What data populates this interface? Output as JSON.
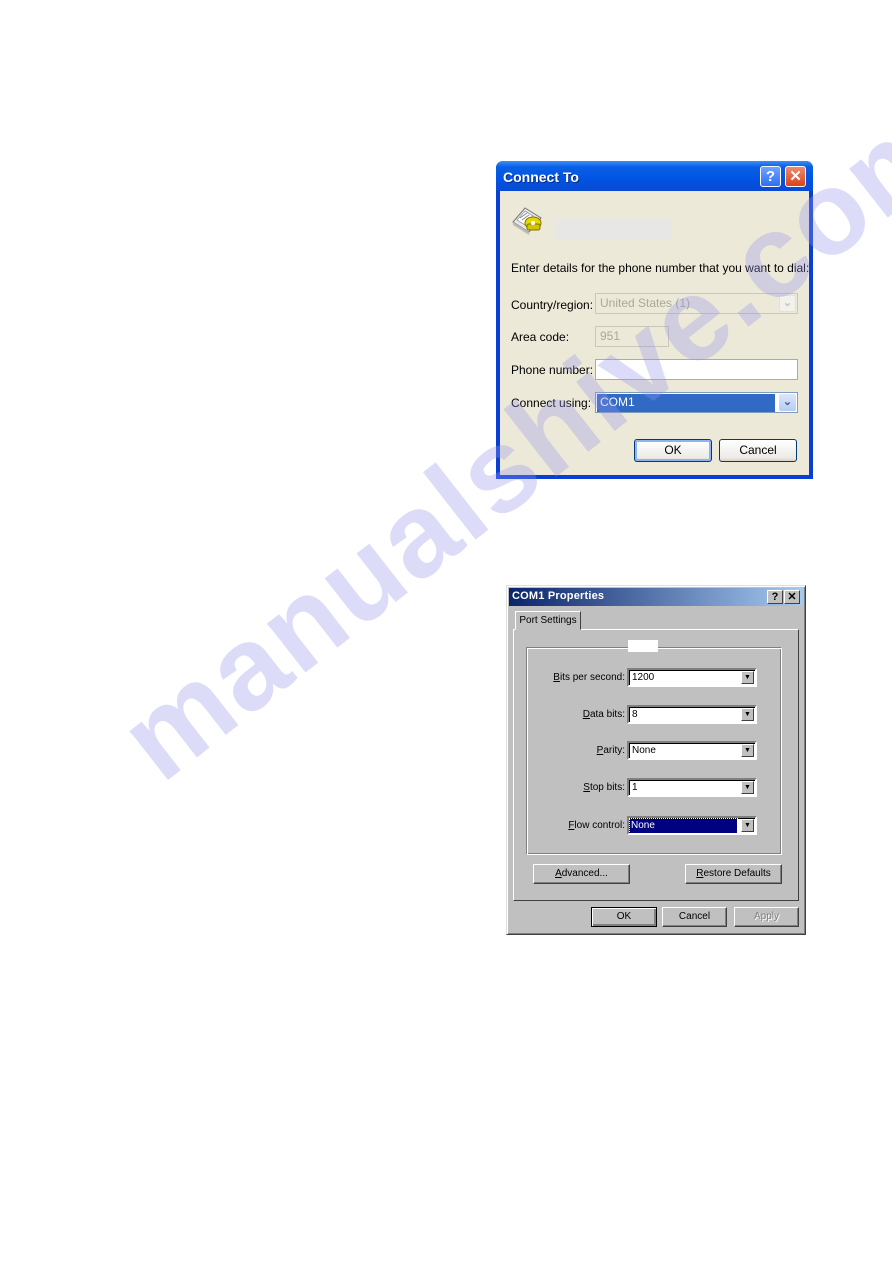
{
  "watermark": "manualshive.com",
  "connect_to": {
    "title": "Connect To",
    "help_glyph": "?",
    "close_glyph": "✕",
    "icon": "phone-fax-icon",
    "instructions": "Enter details for the phone number that you want to dial:",
    "fields": {
      "country": {
        "label": "Country/region:",
        "value": "United States (1)",
        "disabled": true
      },
      "area_code": {
        "label": "Area code:",
        "value": "951",
        "disabled": true
      },
      "phone_number": {
        "label": "Phone number:",
        "value": ""
      },
      "connect_using": {
        "label": "Connect using:",
        "value": "COM1"
      }
    },
    "buttons": {
      "ok": "OK",
      "cancel": "Cancel"
    },
    "dropdown_glyph": "⌄"
  },
  "com_properties": {
    "title": "COM1 Properties",
    "help_glyph": "?",
    "close_glyph": "✕",
    "tab": "Port Settings",
    "fields": [
      {
        "key": "B",
        "rest": "its per second:",
        "value": "1200"
      },
      {
        "key": "D",
        "rest": "ata bits:",
        "value": "8"
      },
      {
        "key": "P",
        "rest": "arity:",
        "value": "None"
      },
      {
        "key": "S",
        "rest": "top bits:",
        "value": "1"
      },
      {
        "key": "F",
        "rest": "low control:",
        "value": "None",
        "selected": true
      }
    ],
    "combo_glyph": "▼",
    "advanced": {
      "key": "A",
      "rest": "dvanced..."
    },
    "restore": {
      "key": "R",
      "rest": "estore Defaults"
    },
    "buttons": {
      "ok": "OK",
      "cancel": "Cancel",
      "apply": "Apply"
    }
  }
}
